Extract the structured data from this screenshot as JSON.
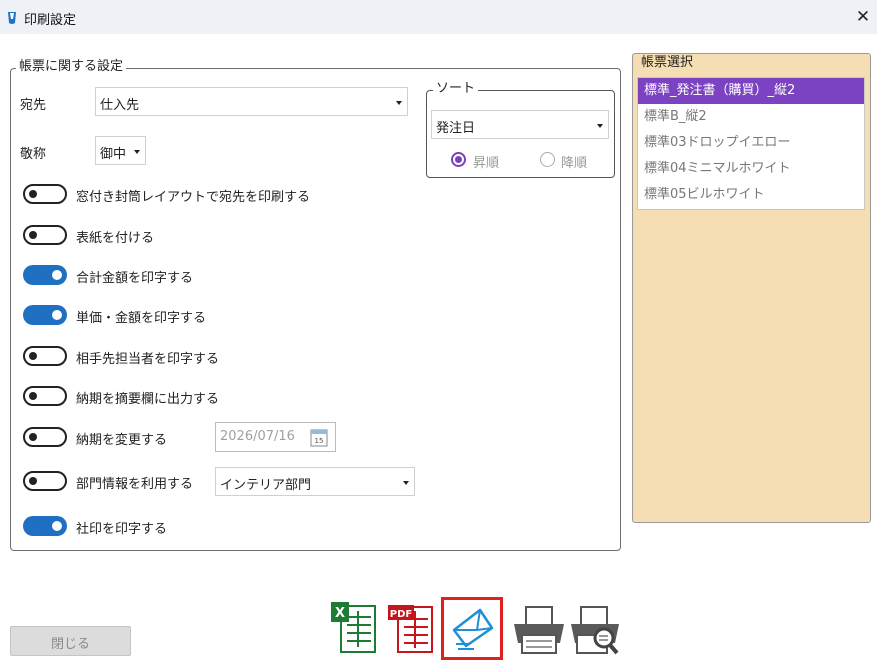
{
  "window": {
    "title": "印刷設定",
    "close_symbol": "✕"
  },
  "settings": {
    "legend": "帳票に関する設定",
    "addressee": {
      "label": "宛先",
      "value": "仕入先"
    },
    "honorific": {
      "label": "敬称",
      "value": "御中"
    },
    "sort": {
      "legend": "ソート",
      "value": "発注日",
      "options": [
        {
          "label": "昇順",
          "selected": true
        },
        {
          "label": "降順",
          "selected": false
        }
      ]
    },
    "toggles": [
      {
        "label": "窓付き封筒レイアウトで宛先を印刷する",
        "on": false
      },
      {
        "label": "表紙を付ける",
        "on": false
      },
      {
        "label": "合計金額を印字する",
        "on": true
      },
      {
        "label": "単価・金額を印字する",
        "on": true
      },
      {
        "label": "相手先担当者を印字する",
        "on": false
      },
      {
        "label": "納期を摘要欄に出力する",
        "on": false
      },
      {
        "label": "納期を変更する",
        "on": false
      },
      {
        "label": "部門情報を利用する",
        "on": false
      },
      {
        "label": "社印を印字する",
        "on": true
      }
    ],
    "delivery_date": "2026/07/16",
    "calendar_day": "15",
    "department": "インテリア部門"
  },
  "form_select": {
    "legend": "帳票選択",
    "items": [
      {
        "label": "標準_発注書（購買）_縦2",
        "selected": true
      },
      {
        "label": "標準B_縦2",
        "selected": false
      },
      {
        "label": "標準03ドロップイエロー",
        "selected": false
      },
      {
        "label": "標準04ミニマルホワイト",
        "selected": false
      },
      {
        "label": "標準05ビルホワイト",
        "selected": false
      }
    ]
  },
  "footer": {
    "close_label": "閉じる",
    "actions": [
      "excel-export-icon",
      "pdf-export-icon",
      "mail-send-icon",
      "print-icon",
      "print-preview-icon"
    ],
    "excel_letter": "X",
    "pdf_text": "PDF"
  },
  "colors": {
    "accent": "#7b42c2",
    "toggle_on": "#1f6fc2",
    "form_panel": "#f5deb3",
    "highlight_border": "#e0201b"
  }
}
